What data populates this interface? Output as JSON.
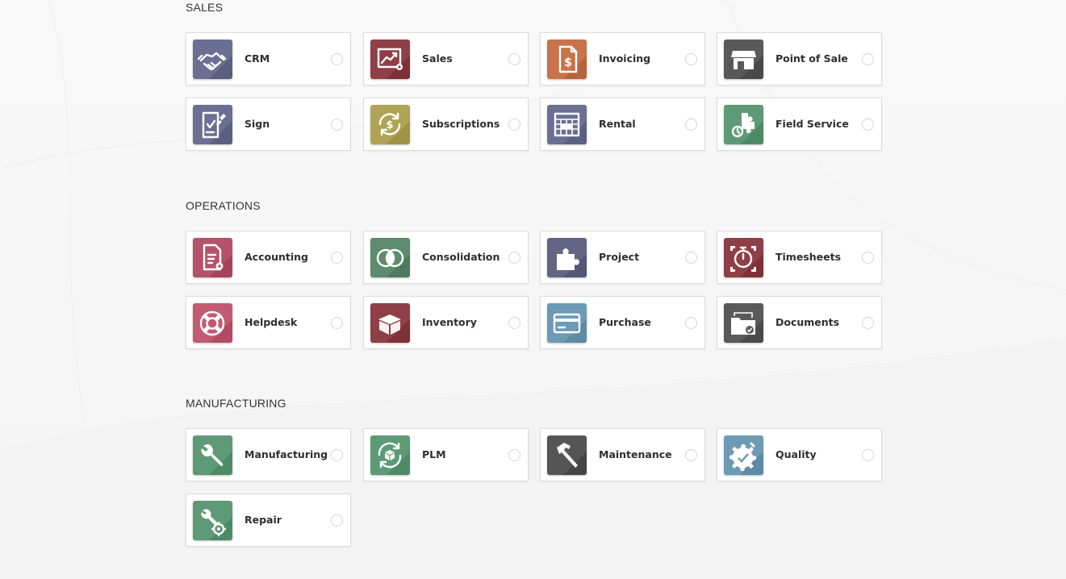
{
  "sections": [
    {
      "title": "SALES",
      "apps": [
        {
          "label": "CRM",
          "icon": "handshake-icon",
          "color": "#6b6f92"
        },
        {
          "label": "Sales",
          "icon": "sales-chart-icon",
          "color": "#8f3f46"
        },
        {
          "label": "Invoicing",
          "icon": "invoice-icon",
          "color": "#c8734a"
        },
        {
          "label": "Point of Sale",
          "icon": "store-icon",
          "color": "#595959"
        },
        {
          "label": "Sign",
          "icon": "sign-icon",
          "color": "#6b6f92"
        },
        {
          "label": "Subscriptions",
          "icon": "subscription-icon",
          "color": "#b0a356"
        },
        {
          "label": "Rental",
          "icon": "rental-calendar-icon",
          "color": "#6b6f92"
        },
        {
          "label": "Field Service",
          "icon": "field-service-icon",
          "color": "#5e9a75"
        }
      ]
    },
    {
      "title": "OPERATIONS",
      "apps": [
        {
          "label": "Accounting",
          "icon": "accounting-icon",
          "color": "#b5526a"
        },
        {
          "label": "Consolidation",
          "icon": "consolidation-icon",
          "color": "#5e8a6d"
        },
        {
          "label": "Project",
          "icon": "puzzle-icon",
          "color": "#646584"
        },
        {
          "label": "Timesheets",
          "icon": "stopwatch-icon",
          "color": "#8f3f46"
        },
        {
          "label": "Helpdesk",
          "icon": "lifebuoy-icon",
          "color": "#c25b72"
        },
        {
          "label": "Inventory",
          "icon": "box-icon",
          "color": "#8f3f46"
        },
        {
          "label": "Purchase",
          "icon": "credit-card-icon",
          "color": "#6d9ab4"
        },
        {
          "label": "Documents",
          "icon": "documents-icon",
          "color": "#5a5a5a"
        }
      ]
    },
    {
      "title": "MANUFACTURING",
      "apps": [
        {
          "label": "Manufacturing",
          "icon": "wrench-icon",
          "color": "#5e9a75"
        },
        {
          "label": "PLM",
          "icon": "plm-cycle-icon",
          "color": "#5e9a75"
        },
        {
          "label": "Maintenance",
          "icon": "hammer-icon",
          "color": "#555555"
        },
        {
          "label": "Quality",
          "icon": "quality-gear-icon",
          "color": "#6d9ab4"
        },
        {
          "label": "Repair",
          "icon": "repair-tools-icon",
          "color": "#5e9a75"
        }
      ]
    }
  ]
}
